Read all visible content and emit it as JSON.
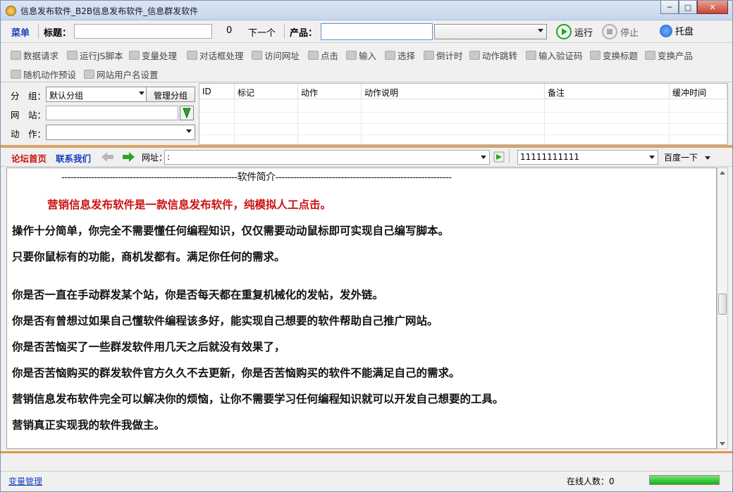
{
  "window": {
    "title": "信息发布软件_B2B信息发布软件_信息群发软件"
  },
  "toolbar": {
    "menu": "菜单",
    "title_label": "标题：",
    "title_value": "",
    "count": "0",
    "next": "下一个",
    "product_label": "产品：",
    "product_value": "",
    "product_select": "",
    "run": "运行",
    "stop": "停止",
    "tray": "托盘"
  },
  "actions": [
    {
      "label": "数据请求",
      "icon": "database-request-icon"
    },
    {
      "label": "运行JS脚本",
      "icon": "js-script-icon"
    },
    {
      "label": "变量处理",
      "icon": "variable-icon"
    },
    {
      "label": "对话框处理",
      "icon": "dialog-icon"
    },
    {
      "label": "访问网址",
      "icon": "visit-url-icon"
    },
    {
      "label": "点击",
      "icon": "click-hand-icon"
    },
    {
      "label": "输入",
      "icon": "input-icon"
    },
    {
      "label": "选择",
      "icon": "select-icon"
    },
    {
      "label": "倒计时",
      "icon": "countdown-icon"
    },
    {
      "label": "动作跳转",
      "icon": "jump-icon"
    },
    {
      "label": "输入验证码",
      "icon": "captcha-icon"
    },
    {
      "label": "变换标题",
      "icon": "change-title-icon"
    },
    {
      "label": "变换产品",
      "icon": "change-product-icon"
    },
    {
      "label": "随机动作预设",
      "icon": "random-preset-icon"
    },
    {
      "label": "网站用户名设置",
      "icon": "site-user-icon"
    }
  ],
  "panel": {
    "group_label": "分　组：",
    "group_value": "默认分组",
    "manage_group": "管理分组",
    "site_label": "网　站：",
    "site_value": "",
    "action_label": "动　作：",
    "action_value": ""
  },
  "grid": {
    "columns": [
      "ID",
      "标记",
      "动作",
      "动作说明",
      "备注",
      "缓冲时间"
    ]
  },
  "nav": {
    "forum": "论坛首页",
    "contact": "联系我们",
    "url_label": "网址：",
    "url_value": ":",
    "search_value": "11111111111",
    "search_engine": "百度一下"
  },
  "content": {
    "heading": "-----------------------------------------------------------软件简介-----------------------------------------------------------",
    "lines": [
      "营销信息发布软件是一款信息发布软件，纯模拟人工点击。",
      "操作十分简单，你完全不需要懂任何编程知识，仅仅需要动动鼠标即可实现自己编写脚本。",
      "只要你鼠标有的功能，商机发都有。满足你任何的需求。",
      "你是否一直在手动群发某个站，你是否每天都在重复机械化的发帖，发外链。",
      "你是否有曾想过如果自己懂软件编程该多好，能实现自己想要的软件帮助自己推广网站。",
      "你是否苦恼买了一些群发软件用几天之后就没有效果了，",
      "你是否苦恼购买的群发软件官方久久不去更新，你是否苦恼购买的软件不能满足自己的需求。",
      "营销信息发布软件完全可以解决你的烦恼，让你不需要学习任何编程知识就可以开发自己想要的工具。",
      "营销真正实现我的软件我做主。"
    ]
  },
  "status": {
    "var_manage": "变量管理",
    "online": "在线人数：0",
    "progress": 1.0
  },
  "colors": {
    "accent": "#1a3fbf",
    "red": "#cc1010",
    "divider": "#d9a367",
    "green": "#1fb01f"
  }
}
